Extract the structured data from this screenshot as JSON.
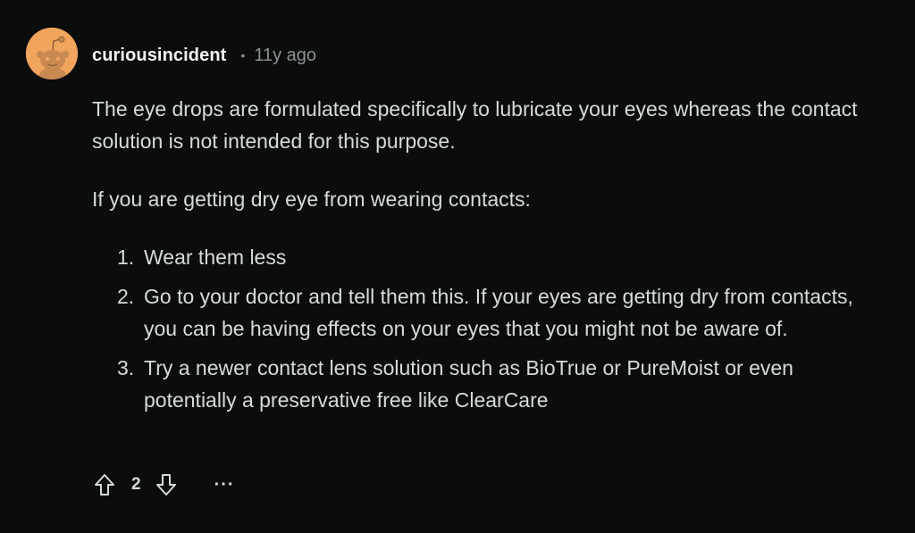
{
  "comment": {
    "author": "curiousincident",
    "separator": "•",
    "age": "11y ago",
    "paragraphs": [
      "The eye drops are formulated specifically to lubricate your eyes whereas the contact solution is not intended for this purpose.",
      "If you are getting dry eye from wearing contacts:"
    ],
    "list": [
      {
        "num": "1.",
        "text": "Wear them less"
      },
      {
        "num": "2.",
        "text": "Go to your doctor and tell them this. If your eyes are getting dry from contacts, you can be having effects on your eyes that you might not be aware of."
      },
      {
        "num": "3.",
        "text": "Try a newer contact lens solution such as BioTrue or PureMoist or even potentially a preservative free like ClearCare"
      }
    ],
    "score": "2",
    "more_label": "···"
  },
  "icons": {
    "avatar": "snoo-avatar-icon",
    "upvote": "upvote-arrow-icon",
    "downvote": "downvote-arrow-icon",
    "more": "more-options-icon"
  },
  "colors": {
    "background": "#0b0c0c",
    "text": "#d7dadc",
    "username": "#f2f3f4",
    "muted": "#8d9196",
    "avatar_bg": "#f1a45c"
  }
}
